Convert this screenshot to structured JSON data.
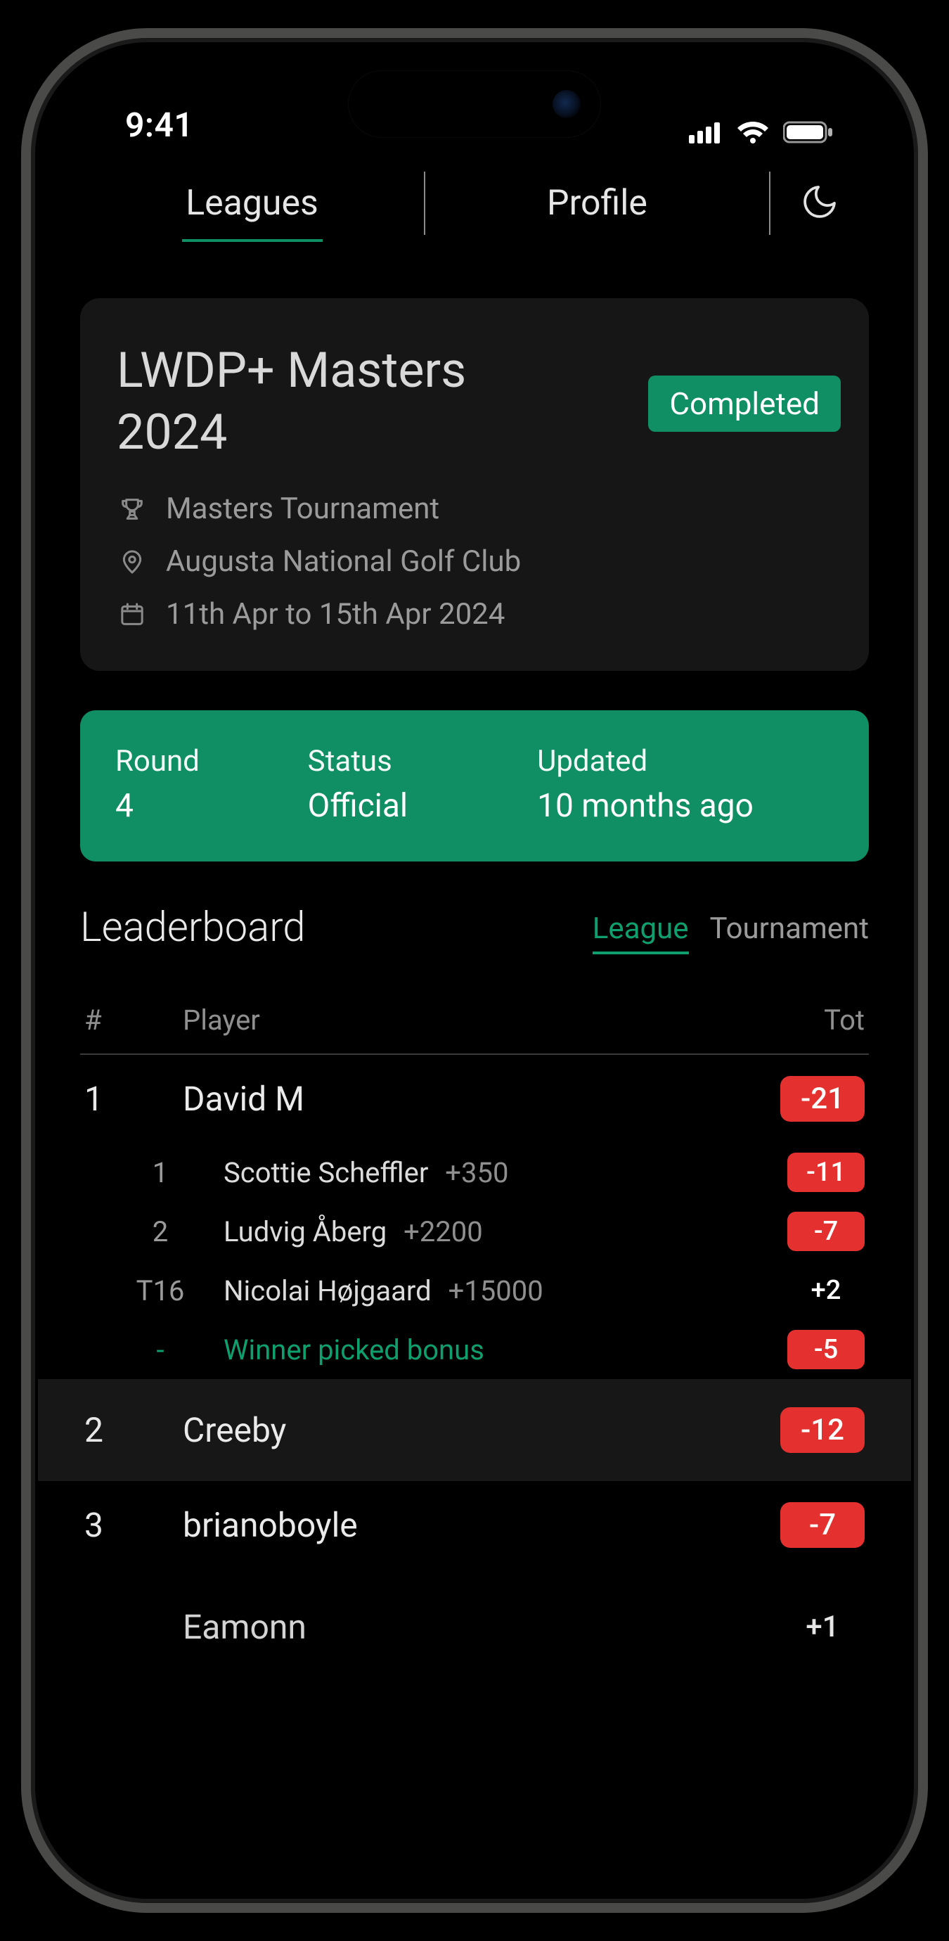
{
  "status_bar": {
    "time": "9:41"
  },
  "nav": {
    "tabs": [
      {
        "label": "Leagues",
        "active": true
      },
      {
        "label": "Profile",
        "active": false
      }
    ]
  },
  "league_card": {
    "title": "LWDP+ Masters 2024",
    "status_badge": "Completed",
    "tournament": "Masters Tournament",
    "venue": "Augusta National Golf Club",
    "dates": "11th Apr to 15th Apr 2024"
  },
  "status_strip": {
    "round_label": "Round",
    "round_value": "4",
    "status_label": "Status",
    "status_value": "Official",
    "updated_label": "Updated",
    "updated_value": "10 months ago"
  },
  "leaderboard": {
    "title": "Leaderboard",
    "tabs": [
      {
        "label": "League",
        "active": true
      },
      {
        "label": "Tournament",
        "active": false
      }
    ],
    "columns": {
      "rank": "#",
      "player": "Player",
      "total": "Tot"
    },
    "rows": [
      {
        "rank": "1",
        "player": "David M",
        "total": "-21",
        "total_style": "red",
        "picks": [
          {
            "rank": "1",
            "name": "Scottie Scheffler",
            "odds": "+350",
            "total": "-11",
            "total_style": "red"
          },
          {
            "rank": "2",
            "name": "Ludvig Åberg",
            "odds": "+2200",
            "total": "-7",
            "total_style": "red"
          },
          {
            "rank": "T16",
            "name": "Nicolai Højgaard",
            "odds": "+15000",
            "total": "+2",
            "total_style": "white"
          },
          {
            "rank": "-",
            "name": "Winner picked bonus",
            "odds": "",
            "total": "-5",
            "total_style": "red",
            "bonus": true
          }
        ]
      },
      {
        "rank": "2",
        "player": "Creeby",
        "total": "-12",
        "total_style": "red",
        "alt": true
      },
      {
        "rank": "3",
        "player": "brianoboyle",
        "total": "-7",
        "total_style": "red"
      },
      {
        "rank": "",
        "player": "Eamonn",
        "total": "+1",
        "total_style": "white",
        "partial": true
      }
    ]
  }
}
